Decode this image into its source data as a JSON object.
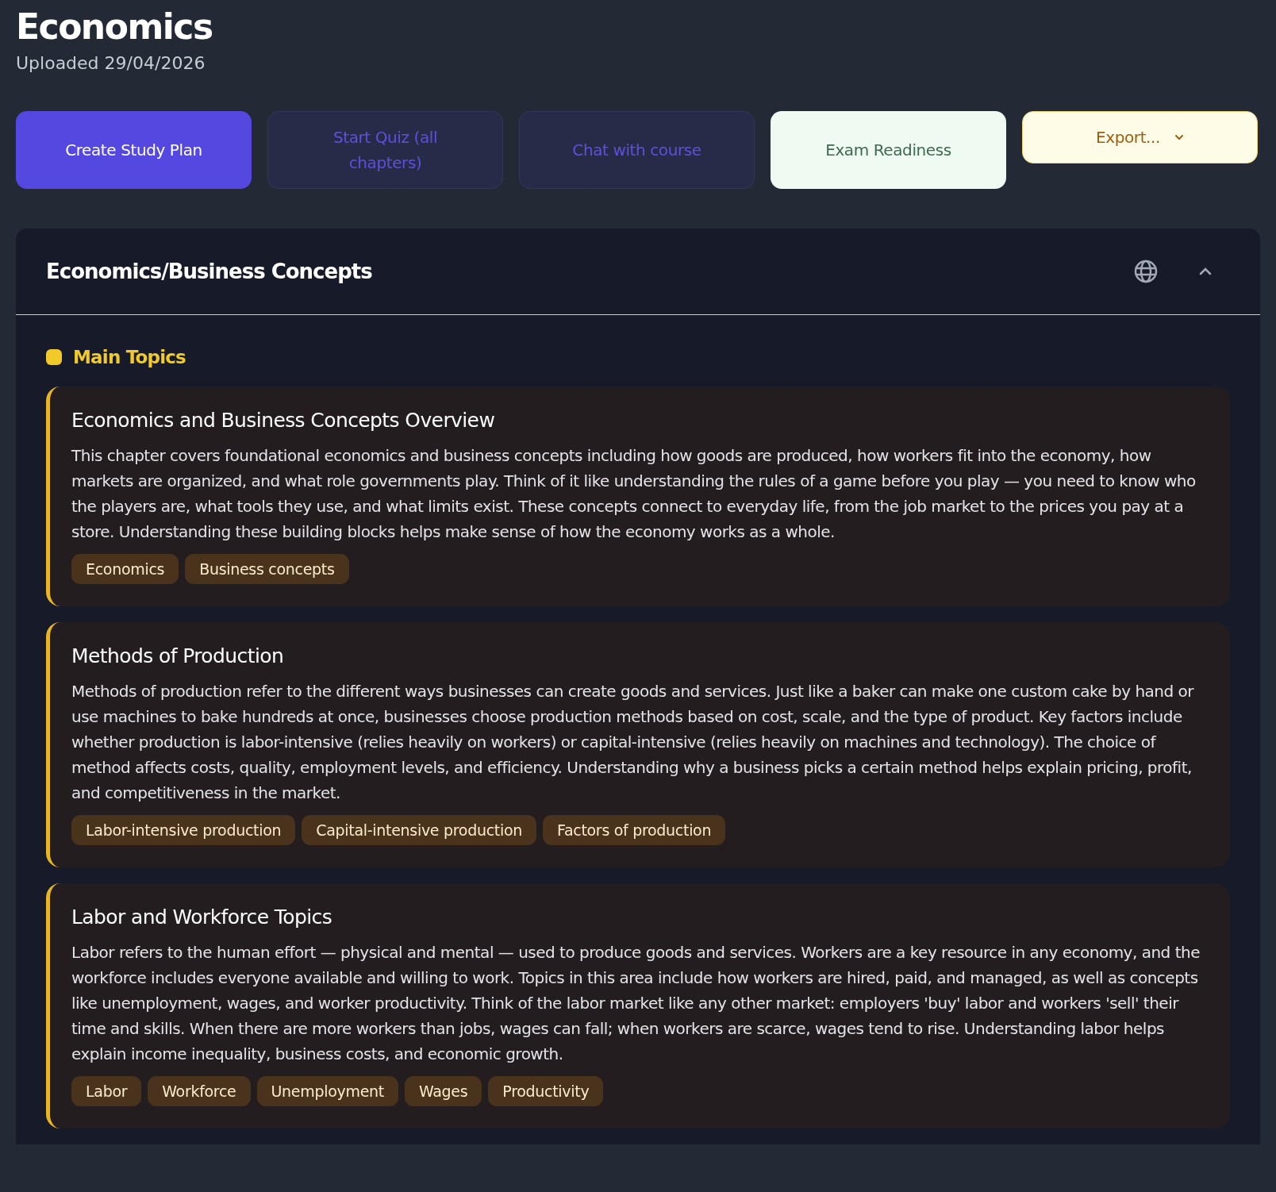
{
  "title": "Economics",
  "subtitle": "Uploaded 29/04/2026",
  "actions": [
    {
      "label": "Create Study Plan",
      "kind": "primary"
    },
    {
      "label": "Start Quiz (all chapters)",
      "kind": "ghost"
    },
    {
      "label": "Chat with course",
      "kind": "ghost"
    },
    {
      "label": "Exam Readiness",
      "kind": "success"
    },
    {
      "label": "Export...",
      "kind": "dropdown"
    }
  ],
  "section": {
    "title": "Economics/Business Concepts",
    "expanded": true,
    "group_label": "Main Topics",
    "topics": [
      {
        "title": "Economics and Business Concepts Overview",
        "text": "This chapter covers foundational economics and business concepts including how goods are produced, how workers fit into the economy, how markets are organized, and what role governments play. Think of it like understanding the rules of a game before you play — you need to know who the players are, what tools they use, and what limits exist. These concepts connect to everyday life, from the job market to the prices you pay at a store. Understanding these building blocks helps make sense of how the economy works as a whole.",
        "tags": [
          "Economics",
          "Business concepts"
        ]
      },
      {
        "title": "Methods of Production",
        "text": "Methods of production refer to the different ways businesses can create goods and services. Just like a baker can make one custom cake by hand or use machines to bake hundreds at once, businesses choose production methods based on cost, scale, and the type of product. Key factors include whether production is labor-intensive (relies heavily on workers) or capital-intensive (relies heavily on machines and technology). The choice of method affects costs, quality, employment levels, and efficiency. Understanding why a business picks a certain method helps explain pricing, profit, and competitiveness in the market.",
        "tags": [
          "Labor-intensive production",
          "Capital-intensive production",
          "Factors of production"
        ]
      },
      {
        "title": "Labor and Workforce Topics",
        "text": "Labor refers to the human effort — physical and mental — used to produce goods and services. Workers are a key resource in any economy, and the workforce includes everyone available and willing to work. Topics in this area include how workers are hired, paid, and managed, as well as concepts like unemployment, wages, and worker productivity. Think of the labor market like any other market: employers 'buy' labor and workers 'sell' their time and skills. When there are more workers than jobs, wages can fall; when workers are scarce, wages tend to rise. Understanding labor helps explain income inequality, business costs, and economic growth.",
        "tags": [
          "Labor",
          "Workforce",
          "Unemployment",
          "Wages",
          "Productivity"
        ]
      }
    ]
  }
}
